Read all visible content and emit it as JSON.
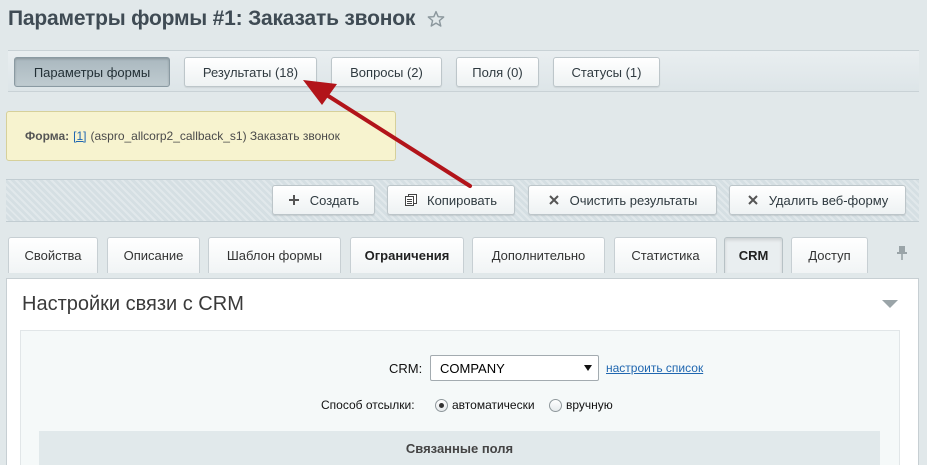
{
  "page": {
    "title": "Параметры формы #1: Заказать звонок"
  },
  "top_tabs": [
    {
      "label": "Параметры формы",
      "active": true
    },
    {
      "label": "Результаты (18)",
      "active": false
    },
    {
      "label": "Вопросы (2)",
      "active": false
    },
    {
      "label": "Поля (0)",
      "active": false
    },
    {
      "label": "Статусы (1)",
      "active": false
    }
  ],
  "note": {
    "label": "Форма:",
    "link": "[1]",
    "text": "(aspro_allcorp2_callback_s1) Заказать звонок"
  },
  "actions": {
    "create": {
      "label": "Создать",
      "icon": "plus-icon"
    },
    "copy": {
      "label": "Копировать",
      "icon": "copy-icon"
    },
    "clear": {
      "label": "Очистить результаты",
      "icon": "close-icon"
    },
    "delete": {
      "label": "Удалить веб-форму",
      "icon": "close-icon"
    }
  },
  "tabs": [
    {
      "label": "Свойства"
    },
    {
      "label": "Описание"
    },
    {
      "label": "Шаблон формы"
    },
    {
      "label": "Ограничения"
    },
    {
      "label": "Дополнительно"
    },
    {
      "label": "Статистика"
    },
    {
      "label": "CRM",
      "active": true
    },
    {
      "label": "Доступ"
    }
  ],
  "panel": {
    "title": "Настройки связи с CRM",
    "crm_label": "CRM:",
    "crm_value": "COMPANY",
    "configure_link": "настроить список",
    "send_label": "Способ отсылки:",
    "send_options": [
      {
        "label": "автоматически",
        "checked": true
      },
      {
        "label": "вручную",
        "checked": false
      }
    ],
    "section_header": "Связанные поля"
  },
  "colors": {
    "annotation_arrow": "#b2141a",
    "link": "#2067b0",
    "note_bg": "#f7f3cf"
  }
}
